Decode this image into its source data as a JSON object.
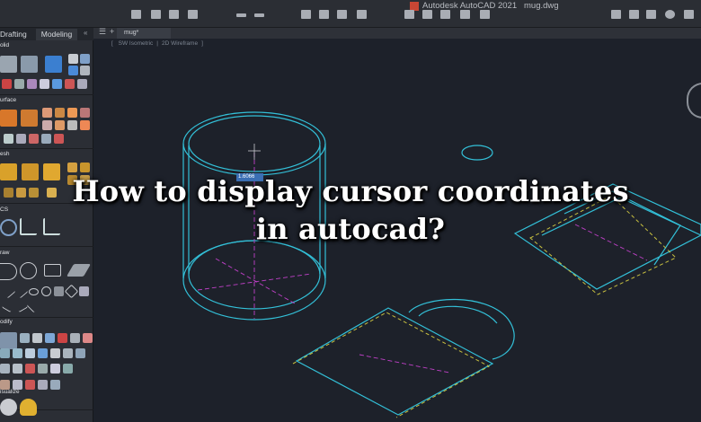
{
  "window": {
    "app_title": "Autodesk AutoCAD 2021",
    "file_name": "mug.dwg"
  },
  "palette": {
    "tabs": [
      "Drafting",
      "Modeling"
    ],
    "sections": [
      "olid",
      "urface",
      "esh",
      "CS",
      "raw",
      "odify",
      "isualize"
    ]
  },
  "document_tab": {
    "name": "mug*"
  },
  "viewport": {
    "view": "SW Isometric",
    "visual_style": "2D Wireframe",
    "coordinate_readout": "1.6066"
  },
  "headline": {
    "line1": "How to display cursor coordinates",
    "line2": "in autocad?"
  },
  "colors": {
    "drawing_cyan": "#33c0d8",
    "dashed_yellow": "#c8c040",
    "axis_magenta": "#c040c8",
    "background": "#1d212a"
  }
}
